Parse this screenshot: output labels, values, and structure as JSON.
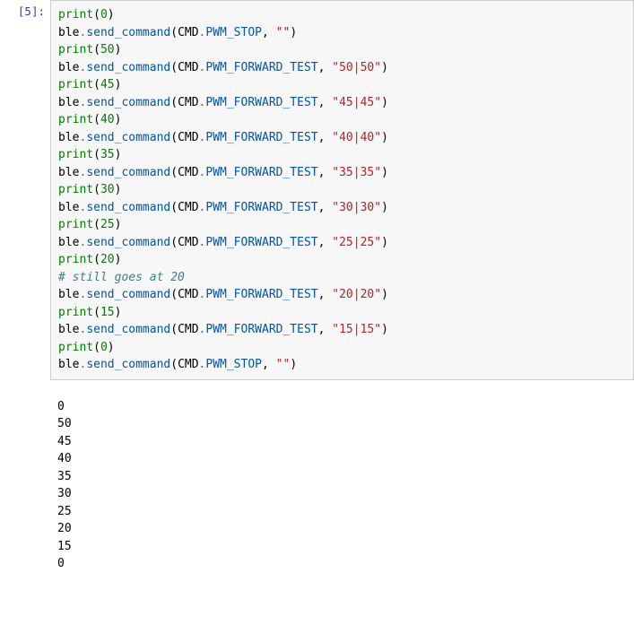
{
  "prompt": {
    "in_label": "[5]:"
  },
  "code": {
    "builtin_print": "print",
    "obj_ble": "ble",
    "dot": ".",
    "method_send": "send_command",
    "lparen": "(",
    "rparen": ")",
    "comma_sp": ", ",
    "cmd_obj": "CMD",
    "pwm_stop": "PWM_STOP",
    "pwm_fwd": "PWM_FORWARD_TEST",
    "str_empty": "\"\"",
    "str_5050": "\"50|50\"",
    "str_4545": "\"45|45\"",
    "str_4040": "\"40|40\"",
    "str_3535": "\"35|35\"",
    "str_3030": "\"30|30\"",
    "str_2525": "\"25|25\"",
    "str_2020": "\"20|20\"",
    "str_1515": "\"15|15\"",
    "n0": "0",
    "n50": "50",
    "n45": "45",
    "n40": "40",
    "n35": "35",
    "n30": "30",
    "n25": "25",
    "n20": "20",
    "n15": "15",
    "comment_20": "# still goes at 20"
  },
  "output": {
    "l1": "0",
    "l2": "50",
    "l3": "45",
    "l4": "40",
    "l5": "35",
    "l6": "30",
    "l7": "25",
    "l8": "20",
    "l9": "15",
    "l10": "0"
  }
}
